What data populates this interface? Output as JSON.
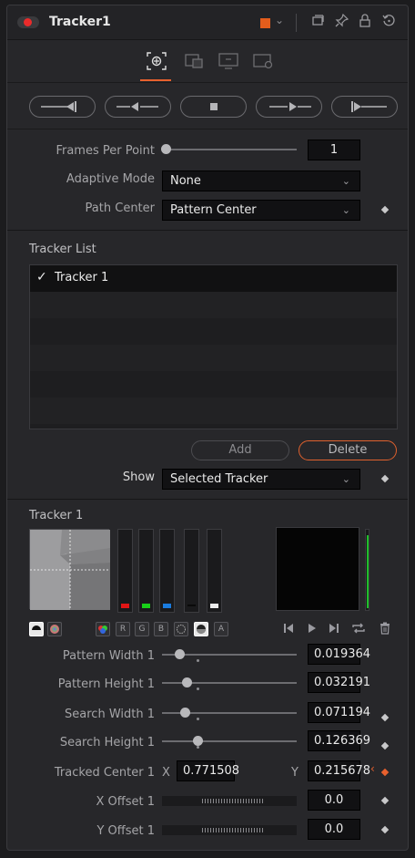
{
  "header": {
    "title": "Tracker1",
    "swatch_color": "#e35d1c",
    "icons": [
      "power-toggle-icon",
      "chevron-down-icon",
      "versions-icon",
      "pin-icon",
      "lock-icon",
      "reset-icon"
    ]
  },
  "tabs": [
    "tracker-controls-tab",
    "operation-tab",
    "display-tab",
    "settings-tab"
  ],
  "playback": [
    "track-to-start",
    "track-reverse",
    "stop-tracking",
    "track-forward",
    "track-to-end"
  ],
  "frames_per_point": {
    "label": "Frames Per Point",
    "value": "1"
  },
  "adaptive_mode": {
    "label": "Adaptive Mode",
    "value": "None"
  },
  "path_center": {
    "label": "Path Center",
    "value": "Pattern Center"
  },
  "tracker_list": {
    "title": "Tracker List",
    "items": [
      {
        "name": "Tracker 1",
        "checked": true
      }
    ],
    "add_label": "Add",
    "delete_label": "Delete"
  },
  "show": {
    "label": "Show",
    "value": "Selected Tracker"
  },
  "tracker_section": {
    "title": "Tracker 1",
    "channels": [
      "R",
      "G",
      "B",
      "A"
    ],
    "meter_colors": [
      "#e01515",
      "#18d018",
      "#1a7ce0",
      "#0a0a0a",
      "#ececec"
    ]
  },
  "params": {
    "pattern_width": {
      "label": "Pattern Width 1",
      "value": "0.019364"
    },
    "pattern_height": {
      "label": "Pattern Height 1",
      "value": "0.032191"
    },
    "search_width": {
      "label": "Search Width 1",
      "value": "0.071194"
    },
    "search_height": {
      "label": "Search Height 1",
      "value": "0.126369"
    },
    "tracked_center": {
      "label": "Tracked Center 1",
      "x_label": "X",
      "x_value": "0.771508",
      "y_label": "Y",
      "y_value": "0.215678"
    },
    "x_offset": {
      "label": "X Offset 1",
      "value": "0.0"
    },
    "y_offset": {
      "label": "Y Offset 1",
      "value": "0.0"
    }
  },
  "colors": {
    "accent": "#e8612e",
    "background": "#27272a"
  }
}
